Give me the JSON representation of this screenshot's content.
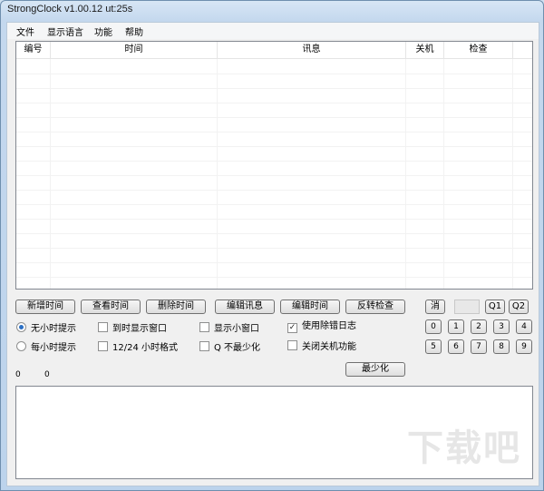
{
  "window": {
    "title": "StrongClock v1.00.12 ut:25s"
  },
  "menu": [
    "文件",
    "显示语言",
    "功能",
    "帮助"
  ],
  "list": {
    "columns": [
      "编号",
      "时间",
      "讯息",
      "关机",
      "检查"
    ]
  },
  "buttons": {
    "add_time": "新增时间",
    "view_time": "查看时间",
    "delete_time": "删除时间",
    "edit_msg": "编辑讯息",
    "edit_time": "编辑时间",
    "invert_check": "反转检查",
    "cancel": "消",
    "q1": "Q1",
    "q2": "Q2",
    "minimize": "最少化"
  },
  "numpad": [
    "0",
    "1",
    "2",
    "3",
    "4",
    "5",
    "6",
    "7",
    "8",
    "9"
  ],
  "options": {
    "no_hourly": "无小时提示",
    "hourly": "每小时提示",
    "show_window_on_time": "到时显示窗口",
    "format_12_24": "12/24 小时格式",
    "show_small_window": "显示小窗口",
    "q_no_minimize": "Q 不最少化",
    "use_debug_log": "使用除错日志",
    "disable_shutdown": "关闭关机功能"
  },
  "option_states": {
    "no_hourly": true,
    "hourly": false,
    "show_window_on_time": false,
    "format_12_24": false,
    "show_small_window": false,
    "q_no_minimize": false,
    "use_debug_log": true,
    "disable_shutdown": false
  },
  "status": {
    "left": "0",
    "right": "0"
  },
  "watermark": "下载吧"
}
